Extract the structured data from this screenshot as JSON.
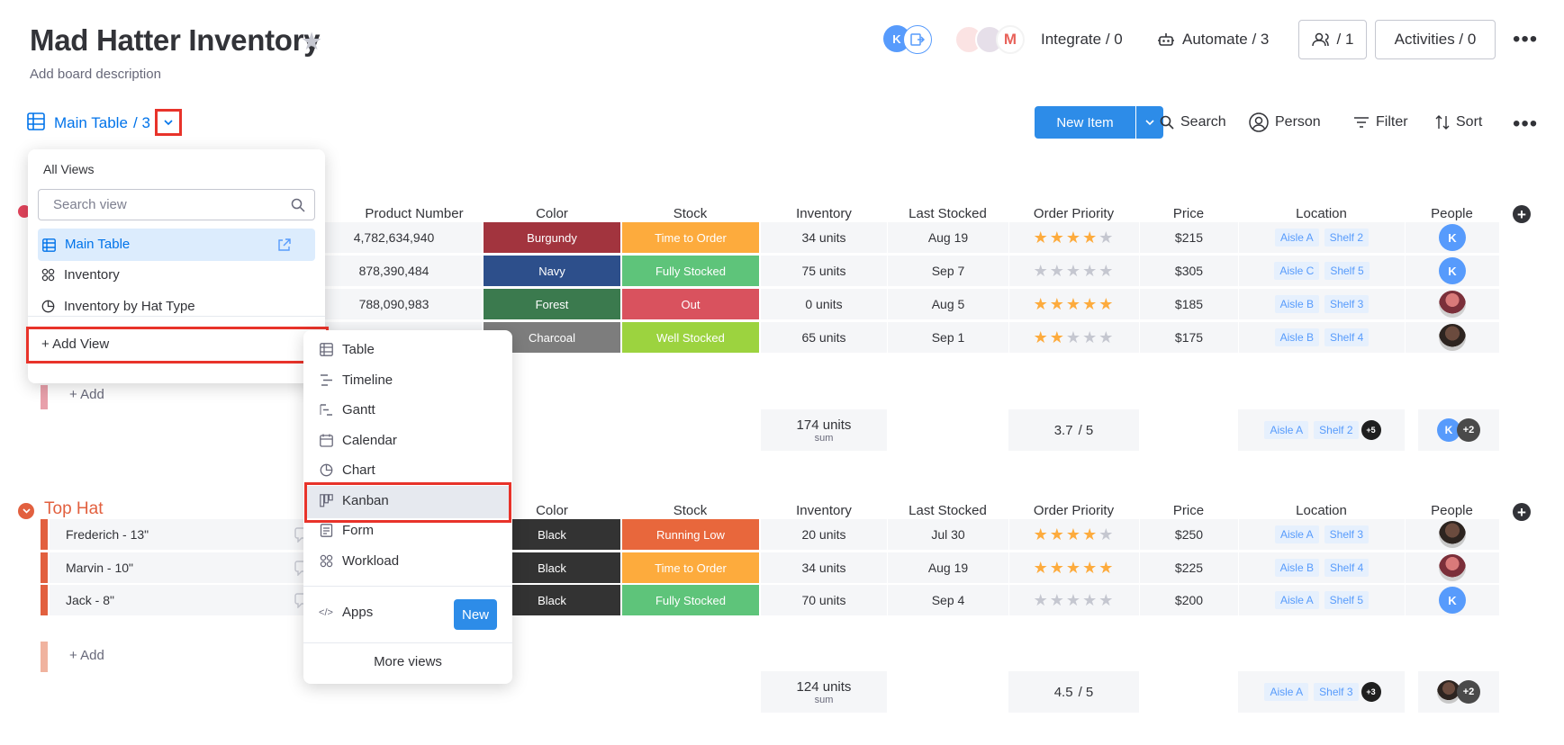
{
  "board": {
    "title": "Mad Hatter Inventory",
    "description": "Add board description"
  },
  "header": {
    "integrate_label": "Integrate / 0",
    "automate_label": "Automate / 3",
    "members_label": "/ 1",
    "activities_label": "Activities / 0",
    "avatar_initial": "K"
  },
  "toolbar": {
    "view_name": "Main Table",
    "view_count": "/ 3",
    "new_item": "New Item",
    "search": "Search",
    "person": "Person",
    "filter": "Filter",
    "sort": "Sort"
  },
  "views_dropdown": {
    "heading": "All Views",
    "search_placeholder": "Search view",
    "views": [
      "Main Table",
      "Inventory",
      "Inventory by Hat Type"
    ],
    "add_view": "+ Add View"
  },
  "add_view_menu": {
    "items": [
      "Table",
      "Timeline",
      "Gantt",
      "Calendar",
      "Chart",
      "Kanban",
      "Form",
      "Workload"
    ],
    "apps_label": "Apps",
    "new_badge": "New",
    "more_views": "More views"
  },
  "columns": {
    "product_number": "Product Number",
    "color": "Color",
    "stock": "Stock",
    "inventory": "Inventory",
    "last_stocked": "Last Stocked",
    "order_priority": "Order Priority",
    "price": "Price",
    "location": "Location",
    "people": "People"
  },
  "group1": {
    "rows": [
      {
        "product_number": "4,782,634,940",
        "color": "Burgundy",
        "color_hex": "#a2343e",
        "stock": "Time to Order",
        "stock_hex": "#fdab3d",
        "inventory": "34 units",
        "last_stocked": "Aug 19",
        "rating": 4,
        "price": "$215",
        "aisle": "Aisle A",
        "shelf": "Shelf 2",
        "person": "K"
      },
      {
        "product_number": "878,390,484",
        "color": "Navy",
        "color_hex": "#2d4f8b",
        "stock": "Fully Stocked",
        "stock_hex": "#5ec47a",
        "inventory": "75 units",
        "last_stocked": "Sep 7",
        "rating": 0,
        "price": "$305",
        "aisle": "Aisle C",
        "shelf": "Shelf 5",
        "person": "K"
      },
      {
        "product_number": "788,090,983",
        "color": "Forest",
        "color_hex": "#3b7a4e",
        "stock": "Out",
        "stock_hex": "#d9525e",
        "inventory": "0 units",
        "last_stocked": "Aug 5",
        "rating": 5,
        "price": "$185",
        "aisle": "Aisle B",
        "shelf": "Shelf 3",
        "person": ""
      },
      {
        "product_number": "",
        "color": "Charcoal",
        "color_hex": "#7d7d7d",
        "stock": "Well Stocked",
        "stock_hex": "#9cd33f",
        "inventory": "65 units",
        "last_stocked": "Sep 1",
        "rating": 2,
        "price": "$175",
        "aisle": "Aisle B",
        "shelf": "Shelf 4",
        "person": ""
      }
    ],
    "add_label": "+ Add",
    "summary": {
      "inventory": "174 units",
      "inventory_sub": "sum",
      "priority": "3.7",
      "priority_max": "/ 5",
      "aisle": "Aisle A",
      "shelf": "Shelf 2",
      "location_more": "+5",
      "people_more": "+2"
    }
  },
  "group2": {
    "name": "Top Hat",
    "color_hex": "#e2603f",
    "rows": [
      {
        "name": "Frederich - 13\"",
        "color": "Black",
        "stock": "Running Low",
        "stock_hex": "#e8673c",
        "inventory": "20 units",
        "last_stocked": "Jul 30",
        "rating": 4,
        "price": "$250",
        "aisle": "Aisle A",
        "shelf": "Shelf 3",
        "person": ""
      },
      {
        "name": "Marvin - 10\"",
        "color": "Black",
        "stock": "Time to Order",
        "stock_hex": "#fdab3d",
        "inventory": "34 units",
        "last_stocked": "Aug 19",
        "rating": 5,
        "price": "$225",
        "aisle": "Aisle B",
        "shelf": "Shelf 4",
        "person": ""
      },
      {
        "name": "Jack - 8\"",
        "color": "Black",
        "stock": "Fully Stocked",
        "stock_hex": "#5ec47a",
        "inventory": "70 units",
        "last_stocked": "Sep 4",
        "rating": 0,
        "price": "$200",
        "aisle": "Aisle A",
        "shelf": "Shelf 5",
        "person": "K"
      }
    ],
    "add_label": "+ Add",
    "summary": {
      "inventory": "124 units",
      "inventory_sub": "sum",
      "priority": "4.5",
      "priority_max": "/ 5",
      "aisle": "Aisle A",
      "shelf": "Shelf 3",
      "location_more": "+3",
      "people_more": "+2"
    }
  },
  "colors": {
    "accent": "#0073ea",
    "highlight_red": "#e8332a",
    "black_cell": "#333333"
  }
}
